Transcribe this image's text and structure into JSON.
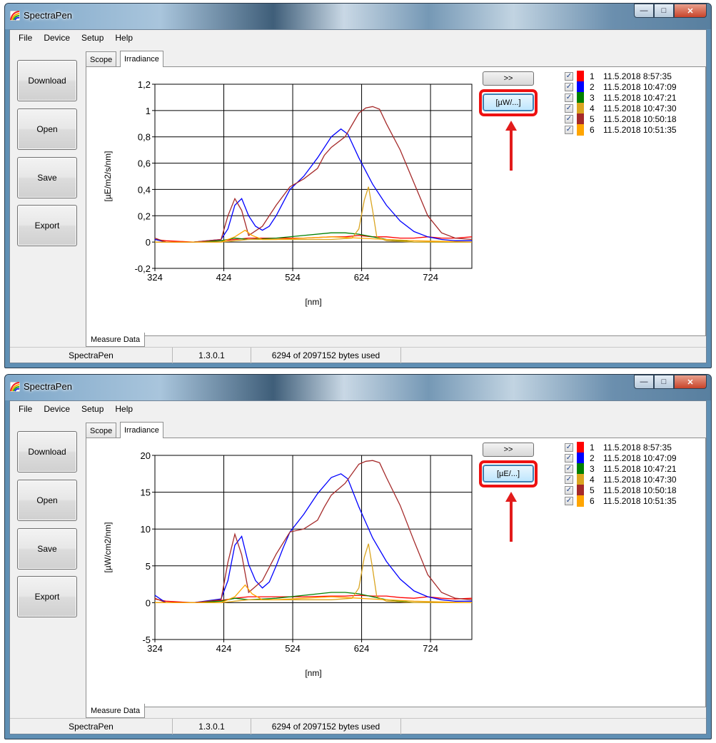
{
  "app": {
    "title": "SpectraPen",
    "menu": [
      "File",
      "Device",
      "Setup",
      "Help"
    ],
    "side_buttons": [
      "Download",
      "Open",
      "Save",
      "Export"
    ],
    "tabs": [
      "Scope",
      "Irradiance"
    ],
    "bottom_tab": "Measure Data",
    "status": {
      "app": "SpectraPen",
      "version": "1.3.0.1",
      "memory": "6294 of 2097152 bytes used"
    },
    "expand_label": ">>",
    "legend": [
      {
        "num": "1",
        "date": "11.5.2018 8:57:35",
        "color": "#ff0000"
      },
      {
        "num": "2",
        "date": "11.5.2018 10:47:09",
        "color": "#0000ff"
      },
      {
        "num": "3",
        "date": "11.5.2018 10:47:21",
        "color": "#008000"
      },
      {
        "num": "4",
        "date": "11.5.2018 10:47:30",
        "color": "#daa520"
      },
      {
        "num": "5",
        "date": "11.5.2018 10:50:18",
        "color": "#a52a2a"
      },
      {
        "num": "6",
        "date": "11.5.2018 10:51:35",
        "color": "#ffa500"
      }
    ],
    "accent": "#e21b1b"
  },
  "windows": [
    {
      "unit_button": "[µW/...]",
      "chart_data": {
        "type": "line",
        "xlabel": "[nm]",
        "ylabel": "[µE/m2/s/nm]",
        "xlim": [
          324,
          784
        ],
        "ylim": [
          -0.2,
          1.2
        ],
        "x_ticks": [
          324,
          424,
          524,
          624,
          724
        ],
        "y_ticks": [
          -0.2,
          0,
          0.2,
          0.4,
          0.6,
          0.8,
          1,
          1.2
        ],
        "y_tick_labels": [
          "-0,2",
          "0",
          "0,2",
          "0,4",
          "0,6",
          "0,8",
          "1",
          "1,2"
        ],
        "grid": true,
        "series": [
          {
            "name": "1",
            "color": "#ff0000",
            "x": [
              324,
              340,
              380,
              420,
              440,
              460,
              500,
              540,
              580,
              600,
              620,
              640,
              660,
              680,
              700,
              720,
              740,
              760,
              784
            ],
            "y": [
              0.02,
              0.01,
              0,
              0.01,
              0.02,
              0.03,
              0.03,
              0.03,
              0.04,
              0.04,
              0.05,
              0.04,
              0.04,
              0.03,
              0.03,
              0.04,
              0.03,
              0.03,
              0.04
            ]
          },
          {
            "name": "2",
            "color": "#0000ff",
            "x": [
              324,
              340,
              380,
              420,
              430,
              440,
              450,
              460,
              470,
              480,
              490,
              500,
              510,
              520,
              540,
              560,
              580,
              594,
              604,
              620,
              640,
              660,
              680,
              700,
              720,
              740,
              760,
              784
            ],
            "y": [
              0.02,
              0,
              0,
              0.02,
              0.1,
              0.28,
              0.33,
              0.2,
              0.12,
              0.09,
              0.12,
              0.2,
              0.3,
              0.4,
              0.5,
              0.64,
              0.8,
              0.86,
              0.82,
              0.64,
              0.44,
              0.28,
              0.16,
              0.08,
              0.04,
              0.02,
              0.01,
              0.01
            ]
          },
          {
            "name": "3",
            "color": "#008000",
            "x": [
              324,
              380,
              420,
              440,
              460,
              500,
              540,
              580,
              600,
              620,
              640,
              660,
              680,
              700,
              784
            ],
            "y": [
              0,
              0,
              0.01,
              0.03,
              0.02,
              0.03,
              0.05,
              0.07,
              0.07,
              0.06,
              0.04,
              0.02,
              0.01,
              0,
              0
            ]
          },
          {
            "name": "4",
            "color": "#daa520",
            "x": [
              324,
              420,
              440,
              460,
              500,
              540,
              580,
              610,
              620,
              628,
              634,
              640,
              646,
              660,
              700,
              784
            ],
            "y": [
              0,
              0,
              0.01,
              0.02,
              0.02,
              0.02,
              0.02,
              0.03,
              0.1,
              0.32,
              0.42,
              0.24,
              0.04,
              0.01,
              0,
              0
            ]
          },
          {
            "name": "5",
            "color": "#a52a2a",
            "x": [
              324,
              340,
              380,
              420,
              430,
              440,
              450,
              460,
              480,
              500,
              520,
              540,
              560,
              570,
              580,
              600,
              620,
              630,
              640,
              650,
              660,
              680,
              700,
              720,
              740,
              760,
              784
            ],
            "y": [
              0.03,
              0,
              0,
              0.02,
              0.2,
              0.33,
              0.24,
              0.05,
              0.12,
              0.28,
              0.42,
              0.48,
              0.56,
              0.66,
              0.72,
              0.8,
              0.98,
              1.02,
              1.03,
              1.01,
              0.9,
              0.7,
              0.45,
              0.2,
              0.07,
              0.03,
              0.02
            ]
          },
          {
            "name": "6",
            "color": "#ffa500",
            "x": [
              324,
              420,
              440,
              455,
              465,
              480,
              500,
              540,
              580,
              620,
              660,
              700,
              784
            ],
            "y": [
              0,
              0,
              0.04,
              0.09,
              0.05,
              0.02,
              0.02,
              0.03,
              0.04,
              0.03,
              0.02,
              0.01,
              0
            ]
          }
        ]
      }
    },
    {
      "unit_button": "[µE/...]",
      "chart_data": {
        "type": "line",
        "xlabel": "[nm]",
        "ylabel": "[µW/cm2/nm]",
        "xlim": [
          324,
          784
        ],
        "ylim": [
          -5,
          20
        ],
        "x_ticks": [
          324,
          424,
          524,
          624,
          724
        ],
        "y_ticks": [
          -5,
          0,
          5,
          10,
          15,
          20
        ],
        "y_tick_labels": [
          "-5",
          "0",
          "5",
          "10",
          "15",
          "20"
        ],
        "grid": true,
        "series": [
          {
            "name": "1",
            "color": "#ff0000",
            "x": [
              324,
              340,
              380,
              420,
              440,
              460,
              500,
              540,
              580,
              600,
              620,
              640,
              660,
              680,
              700,
              720,
              740,
              760,
              784
            ],
            "y": [
              0.5,
              0.2,
              0,
              0.3,
              0.6,
              0.8,
              0.8,
              0.8,
              0.9,
              0.9,
              1,
              0.9,
              0.9,
              0.7,
              0.6,
              0.8,
              0.6,
              0.5,
              0.6
            ]
          },
          {
            "name": "2",
            "color": "#0000ff",
            "x": [
              324,
              340,
              380,
              420,
              430,
              440,
              450,
              460,
              470,
              480,
              490,
              500,
              510,
              520,
              540,
              560,
              580,
              594,
              604,
              620,
              640,
              660,
              680,
              700,
              720,
              740,
              760,
              784
            ],
            "y": [
              1,
              0,
              0,
              0.5,
              3,
              7.8,
              9,
              5.2,
              3,
              2,
              2.8,
              5,
              7.4,
              9.6,
              12,
              14.8,
              17,
              17.5,
              16.8,
              13,
              8.8,
              5.6,
              3.2,
              1.6,
              0.8,
              0.4,
              0.2,
              0.2
            ]
          },
          {
            "name": "3",
            "color": "#008000",
            "x": [
              324,
              380,
              420,
              440,
              460,
              500,
              540,
              580,
              600,
              620,
              640,
              660,
              680,
              700,
              784
            ],
            "y": [
              0,
              0,
              0.2,
              0.6,
              0.4,
              0.6,
              1,
              1.4,
              1.4,
              1.2,
              0.8,
              0.4,
              0.2,
              0,
              0
            ]
          },
          {
            "name": "4",
            "color": "#daa520",
            "x": [
              324,
              420,
              440,
              460,
              500,
              540,
              580,
              610,
              620,
              628,
              634,
              640,
              646,
              660,
              700,
              784
            ],
            "y": [
              0,
              0,
              0.2,
              0.4,
              0.4,
              0.4,
              0.4,
              0.6,
              2,
              6.2,
              8,
              4.6,
              0.8,
              0.2,
              0,
              0
            ]
          },
          {
            "name": "5",
            "color": "#a52a2a",
            "x": [
              324,
              340,
              380,
              420,
              430,
              440,
              450,
              460,
              480,
              500,
              520,
              540,
              560,
              570,
              580,
              600,
              620,
              630,
              640,
              650,
              660,
              680,
              700,
              720,
              740,
              760,
              784
            ],
            "y": [
              0.6,
              0,
              0,
              0.4,
              5.5,
              9.3,
              6.5,
              1.4,
              3,
              6.6,
              9.6,
              10,
              11.2,
              13,
              14.6,
              16.2,
              18.8,
              19.2,
              19.3,
              19,
              17,
              13.2,
              8.4,
              3.8,
              1.4,
              0.6,
              0.4
            ]
          },
          {
            "name": "6",
            "color": "#ffa500",
            "x": [
              324,
              420,
              440,
              455,
              465,
              480,
              500,
              540,
              580,
              620,
              660,
              700,
              784
            ],
            "y": [
              0,
              0,
              0.8,
              2.4,
              1.2,
              0.4,
              0.4,
              0.6,
              0.8,
              0.6,
              0.4,
              0.2,
              0
            ]
          }
        ]
      }
    }
  ]
}
